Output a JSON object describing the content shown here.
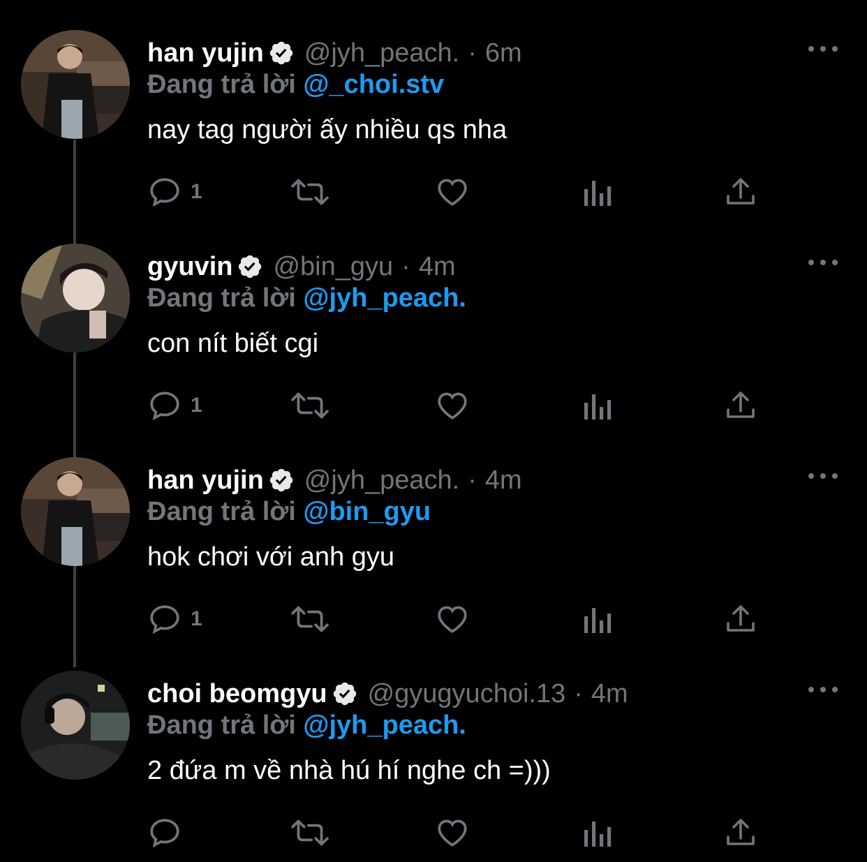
{
  "tweets": [
    {
      "name": "han yujin",
      "handle": "@jyh_peach.",
      "separator": "·",
      "time": "6m",
      "reply_prefix": "Đang trả lời",
      "reply_to": "@_choi.stv",
      "text": "nay tag người ấy nhiều qs nha",
      "reply_count": "1"
    },
    {
      "name": "gyuvin",
      "handle": "@bin_gyu",
      "separator": "·",
      "time": "4m",
      "reply_prefix": "Đang trả lời",
      "reply_to": "@jyh_peach.",
      "text": "con nít biết cgi",
      "reply_count": "1"
    },
    {
      "name": "han yujin",
      "handle": "@jyh_peach.",
      "separator": "·",
      "time": "4m",
      "reply_prefix": "Đang trả lời",
      "reply_to": "@bin_gyu",
      "text": "hok chơi với anh gyu",
      "reply_count": "1"
    },
    {
      "name": "choi beomgyu",
      "handle": "@gyugyuchoi.13",
      "separator": "·",
      "time": "4m",
      "reply_prefix": "Đang trả lời",
      "reply_to": "@jyh_peach.",
      "text": "2 đứa m về nhà hú hí nghe ch =)))",
      "reply_count": ""
    }
  ],
  "icons": {
    "reply": "reply-icon",
    "retweet": "retweet-icon",
    "like": "heart-icon",
    "views": "views-icon",
    "share": "share-icon",
    "more": "more-icon",
    "verified": "verified-badge-icon"
  },
  "colors": {
    "background": "#000000",
    "text": "#ffffff",
    "muted": "#71767b",
    "accent": "#1d9bf0",
    "thread_line": "#3e4144"
  }
}
